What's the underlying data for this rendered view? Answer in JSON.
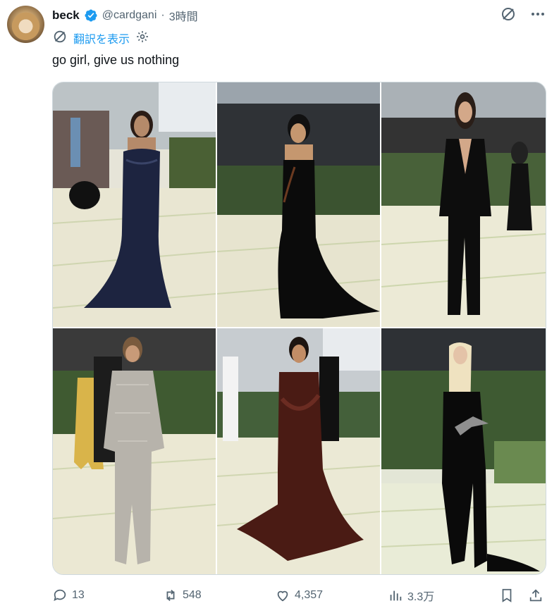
{
  "user": {
    "display_name": "beck",
    "handle": "@cardgani",
    "separator": "·",
    "time": "3時間"
  },
  "translate": {
    "label": "翻訳を表示"
  },
  "tweet": {
    "text": "go girl, give us nothing"
  },
  "media": {
    "count": 6
  },
  "actions": {
    "replies": "13",
    "reposts": "548",
    "likes": "4,357",
    "views": "3.3万"
  },
  "colors": {
    "accent": "#1d9bf0",
    "muted": "#536471",
    "text": "#0f1419",
    "border": "#cfd9de"
  },
  "icons": [
    "verified-badge-icon",
    "grok-icon",
    "more-icon",
    "translate-icon",
    "gear-icon",
    "reply-icon",
    "repost-icon",
    "like-icon",
    "views-icon",
    "bookmark-icon",
    "share-icon"
  ]
}
